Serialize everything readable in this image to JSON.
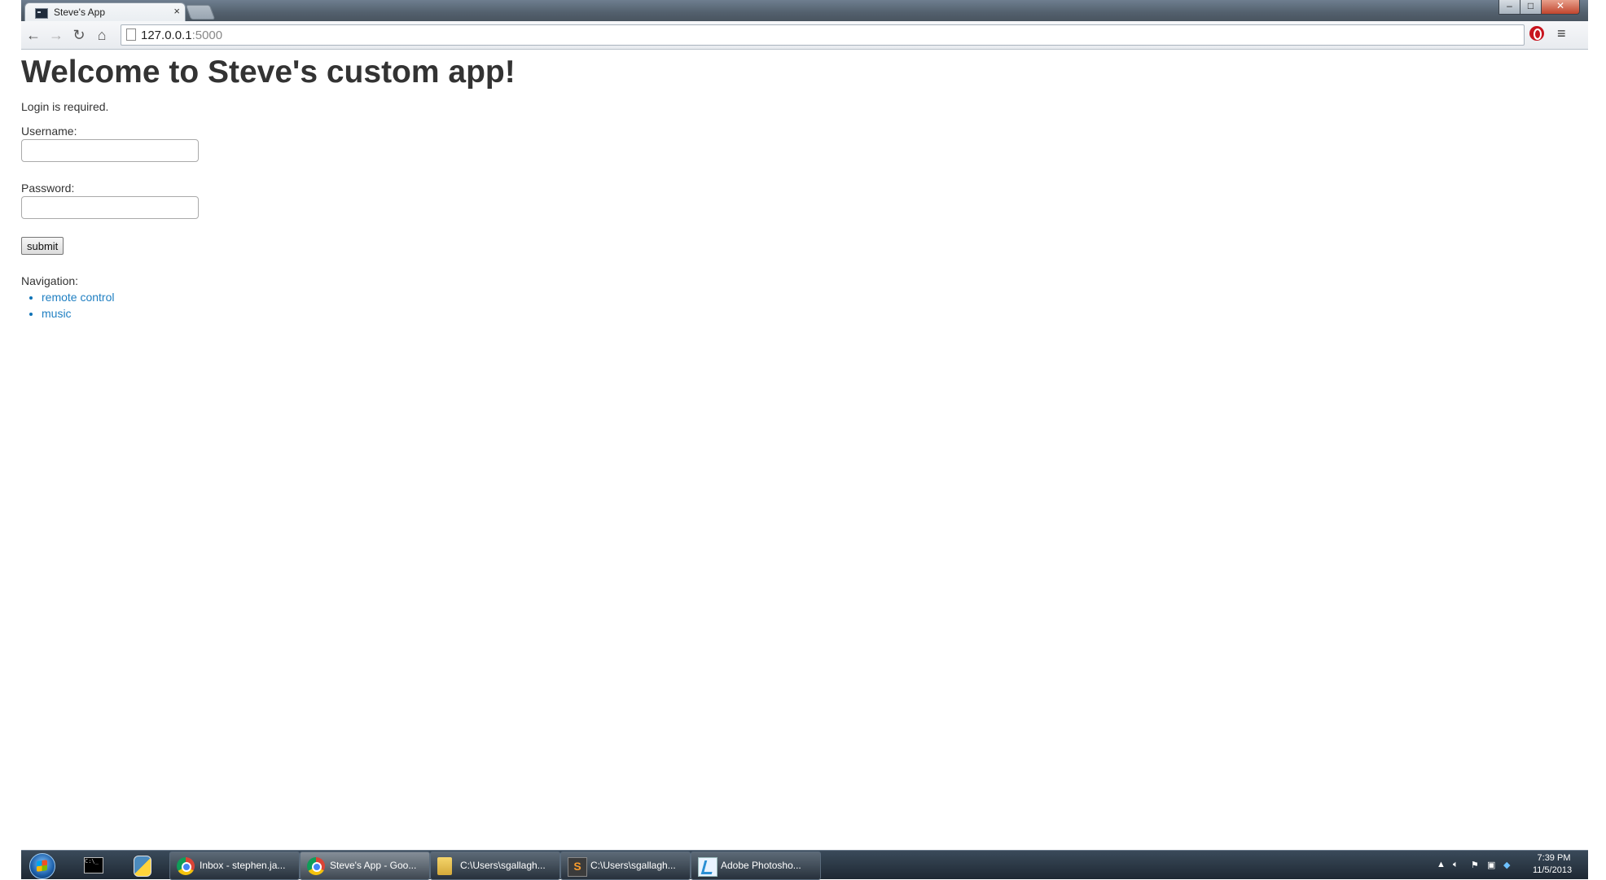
{
  "browser": {
    "tab_title": "Steve's App",
    "tab_close": "×",
    "url_host": "127.0.0.1",
    "url_port": ":5000"
  },
  "page": {
    "title": "Welcome to Steve's custom app!",
    "login_message": "Login is required.",
    "username_label": "Username:",
    "username_value": "",
    "password_label": "Password:",
    "password_value": "",
    "submit_label": "submit",
    "navigation_label": "Navigation:",
    "nav_links": [
      "remote control",
      "music"
    ]
  },
  "taskbar": {
    "tasks": [
      {
        "label": "Inbox - stephen.ja...",
        "icon": "chrome-icon"
      },
      {
        "label": "Steve's App - Goo...",
        "icon": "chrome-icon"
      },
      {
        "label": "C:\\Users\\sgallagh...",
        "icon": "folder-icon"
      },
      {
        "label": "C:\\Users\\sgallagh...",
        "icon": "sublime-text-icon"
      },
      {
        "label": "Adobe Photosho...",
        "icon": "photoshop-icon"
      }
    ],
    "sublime_glyph": "S",
    "clock_time": "7:39 PM",
    "clock_date": "11/5/2013"
  },
  "colors": {
    "link": "#1f7fc2",
    "text": "#333333",
    "taskbar": "#1e2833"
  }
}
